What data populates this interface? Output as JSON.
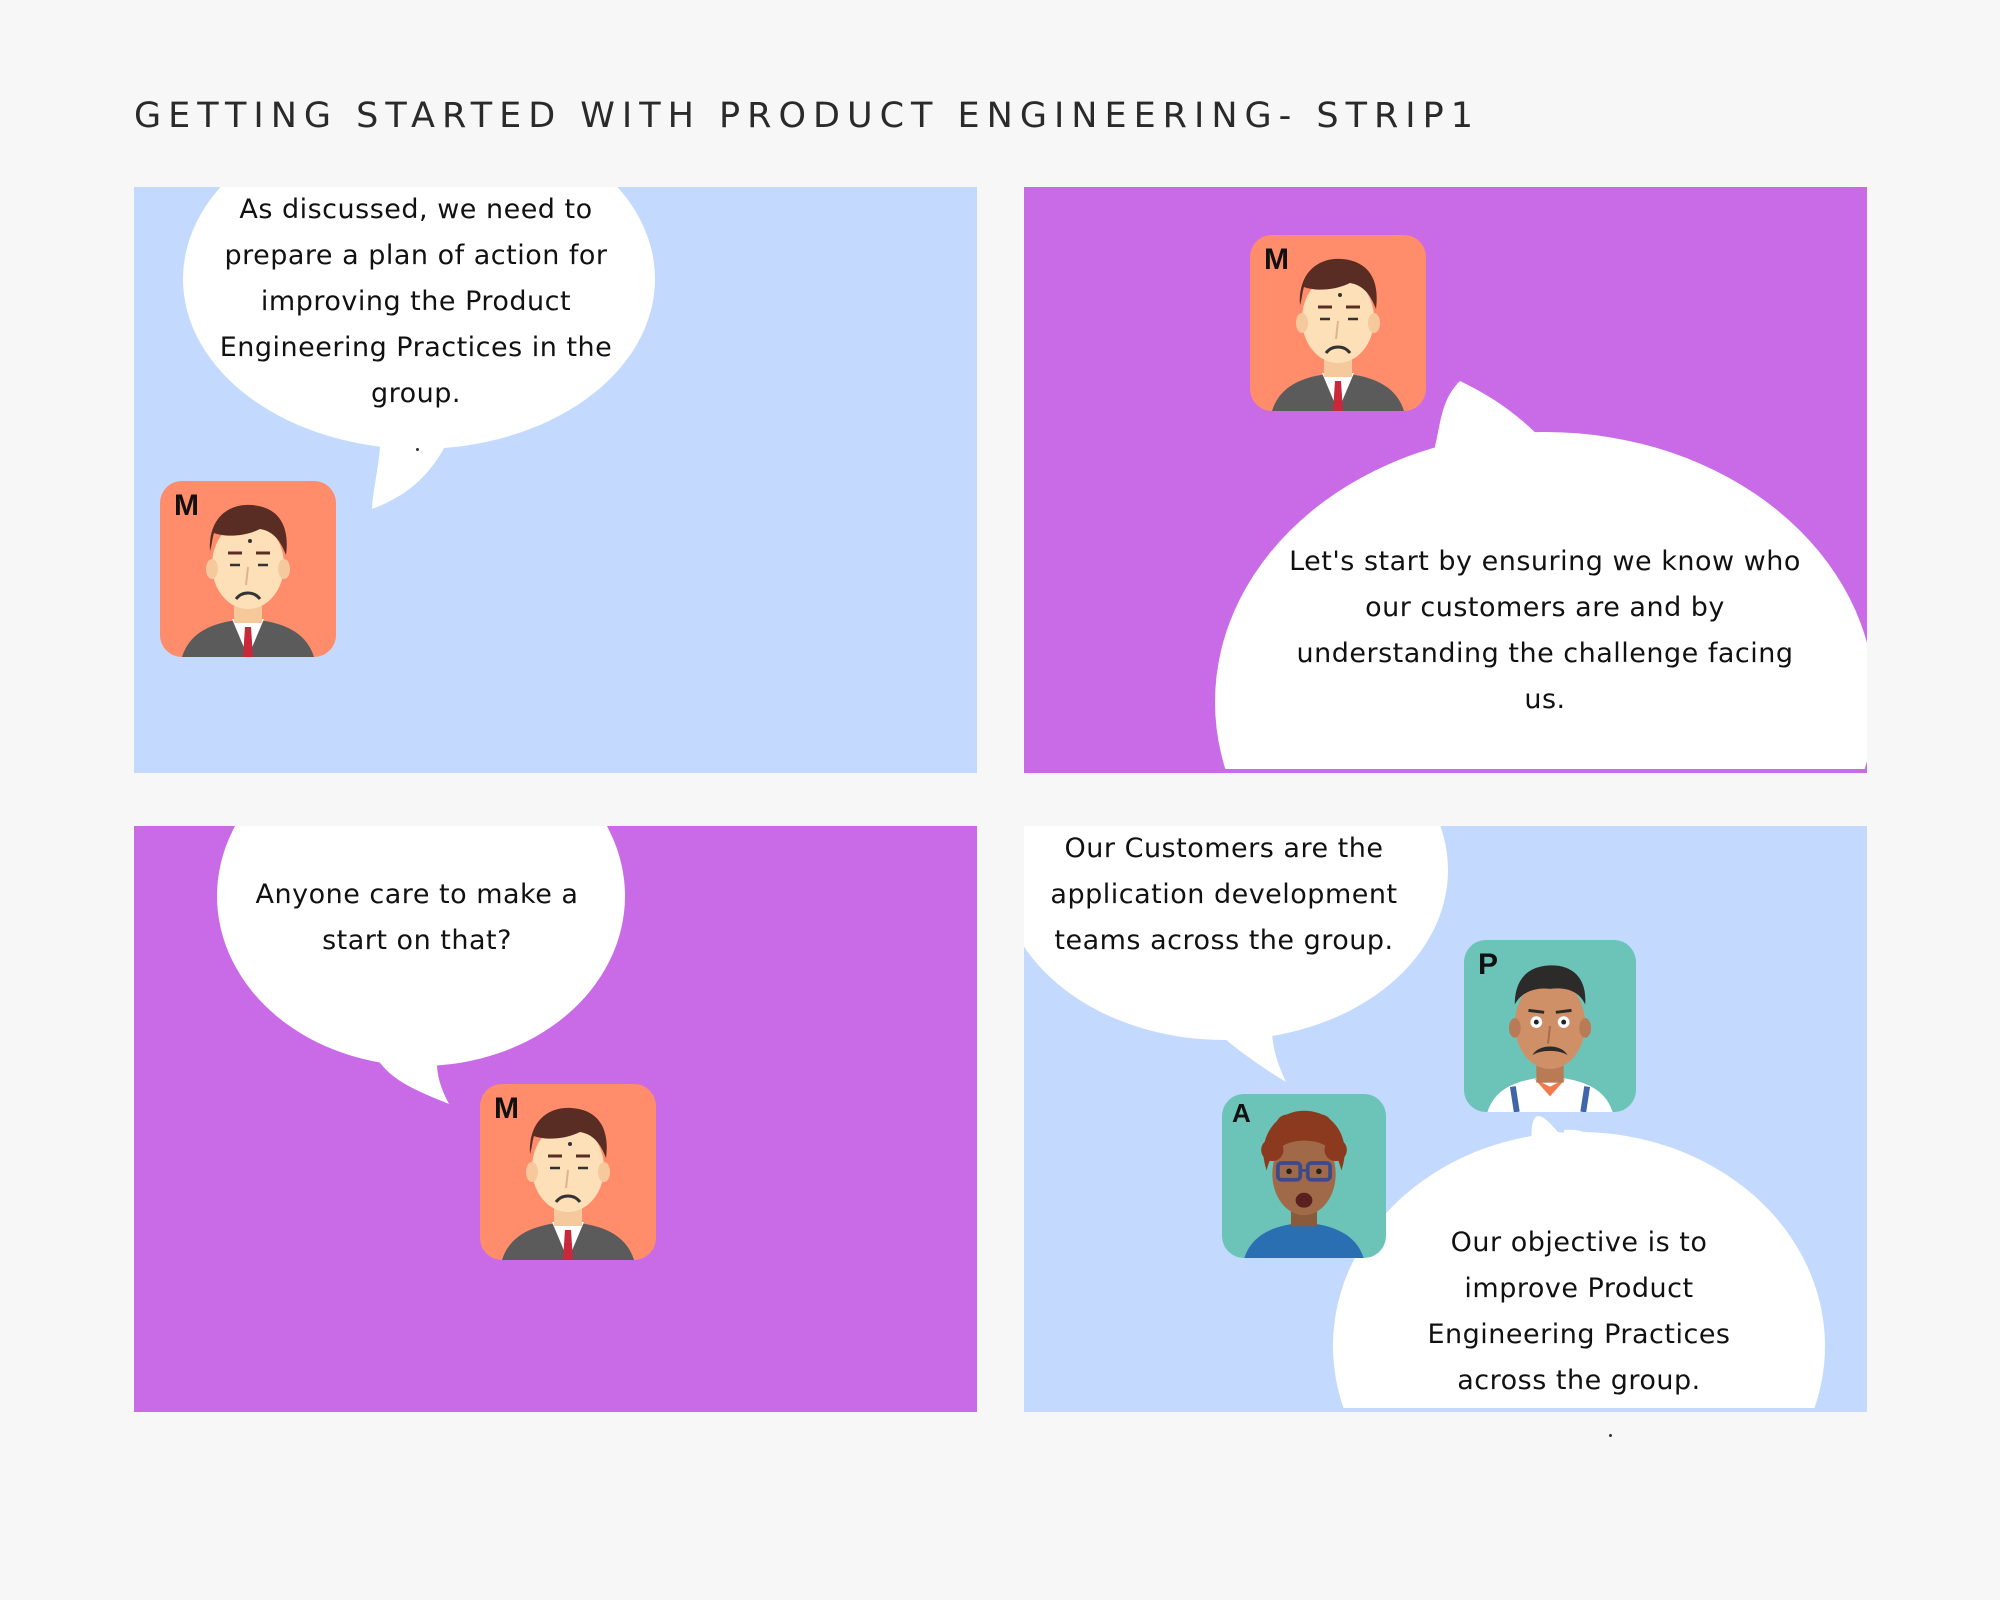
{
  "title": "GETTING STARTED WITH PRODUCT ENGINEERING- STRIP1",
  "colors": {
    "page_bg": "#f7f7f7",
    "panel_blue": "#c3dafe",
    "panel_purple": "#c96ae6",
    "bubble": "#ffffff",
    "avatar_m_bg": "#ff8c6b",
    "avatar_teal_bg": "#6cc4b9"
  },
  "panels": [
    {
      "bubble_text": "As discussed, we need to prepare a plan of action for improving the Product Engineering Practices in the group.",
      "avatars": [
        {
          "letter": "M",
          "icon": "businessman-avatar-icon"
        }
      ]
    },
    {
      "bubble_text": "Let's start by ensuring we know who our customers are and by understanding the challenge facing us.",
      "avatars": [
        {
          "letter": "M",
          "icon": "businessman-avatar-icon"
        }
      ]
    },
    {
      "bubble_text": "Anyone care to make a start on that?",
      "avatars": [
        {
          "letter": "M",
          "icon": "businessman-avatar-icon"
        }
      ]
    },
    {
      "bubble_text_a": "Our Customers are the application development teams across the group.",
      "bubble_text_p": "Our objective is to improve Product Engineering Practices across the group.",
      "avatars": [
        {
          "letter": "P",
          "icon": "mustached-man-avatar-icon"
        },
        {
          "letter": "A",
          "icon": "curly-hair-glasses-avatar-icon"
        }
      ]
    }
  ]
}
